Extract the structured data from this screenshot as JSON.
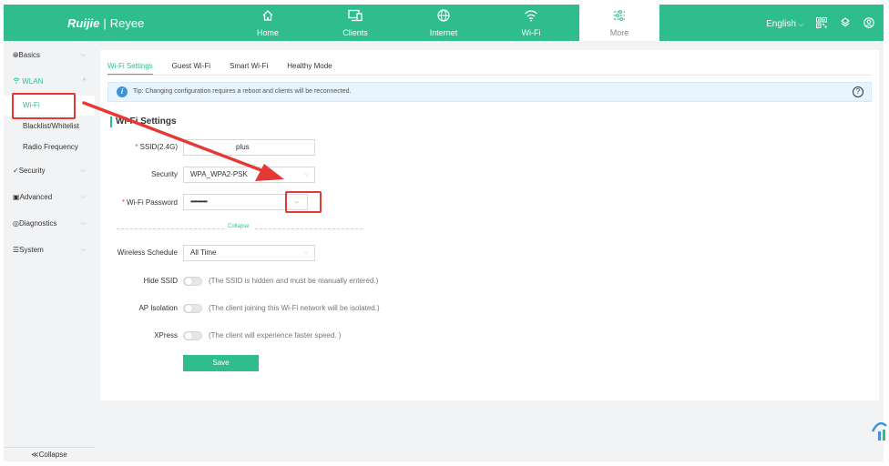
{
  "brand": {
    "logo": "Ruijie",
    "separator": "|",
    "product": "Reyee"
  },
  "nav": [
    {
      "id": "home",
      "label": "Home",
      "icon": "home-icon"
    },
    {
      "id": "clients",
      "label": "Clients",
      "icon": "clients-icon"
    },
    {
      "id": "internet",
      "label": "Internet",
      "icon": "globe-icon"
    },
    {
      "id": "wifi",
      "label": "Wi-Fi",
      "icon": "wifi-icon"
    },
    {
      "id": "more",
      "label": "More",
      "icon": "sliders-icon",
      "active": true
    }
  ],
  "topright": {
    "language": "English",
    "language_arrow": "⌵"
  },
  "sidebar": {
    "groups": [
      {
        "label": "Basics",
        "icon": "globe-icon"
      },
      {
        "label": "WLAN",
        "icon": "wifi-icon",
        "active": true
      },
      {
        "label": "Security",
        "icon": "shield-check-icon"
      },
      {
        "label": "Advanced",
        "icon": "toolbox-icon"
      },
      {
        "label": "Diagnostics",
        "icon": "diagnostics-icon"
      },
      {
        "label": "System",
        "icon": "system-icon"
      }
    ],
    "wlan_items": [
      {
        "label": "Wi-Fi",
        "active": true
      },
      {
        "label": "Blacklist/Whitelist"
      },
      {
        "label": "Radio Frequency"
      }
    ],
    "collapse": "≪Collapse"
  },
  "tabs": [
    {
      "label": "Wi-Fi Settings",
      "active": true
    },
    {
      "label": "Guest Wi-Fi"
    },
    {
      "label": "Smart Wi-Fi"
    },
    {
      "label": "Healthy Mode"
    }
  ],
  "tip": {
    "icon": "i",
    "text": "Tip: Changing configuration requires a reboot and clients will be reconnected.",
    "help": "?"
  },
  "section_title": "Wi-Fi Settings",
  "form": {
    "ssid": {
      "label": "SSID(2.4G)",
      "required": "*",
      "value": "plus"
    },
    "security": {
      "label": "Security",
      "value": "WPA_WPA2-PSK"
    },
    "password": {
      "label": "Wi-Fi Password",
      "required": "*",
      "value": "••••••••••",
      "eye": "⌣"
    },
    "collapse": "Collapse",
    "schedule": {
      "label": "Wireless Schedule",
      "value": "All Time"
    },
    "hide_ssid": {
      "label": "Hide SSID",
      "hint": "(The SSID is hidden and must be manually entered.)"
    },
    "ap_isolation": {
      "label": "AP Isolation",
      "hint": "(The client joining this Wi-Fi network will be isolated.)"
    },
    "xpress": {
      "label": "XPress",
      "hint": "(The client will experience faster speed. )"
    },
    "save": "Save"
  },
  "colors": {
    "brand": "#2fbd8e",
    "annotation": "#e53935",
    "tip_bg": "#e8f4fd"
  }
}
